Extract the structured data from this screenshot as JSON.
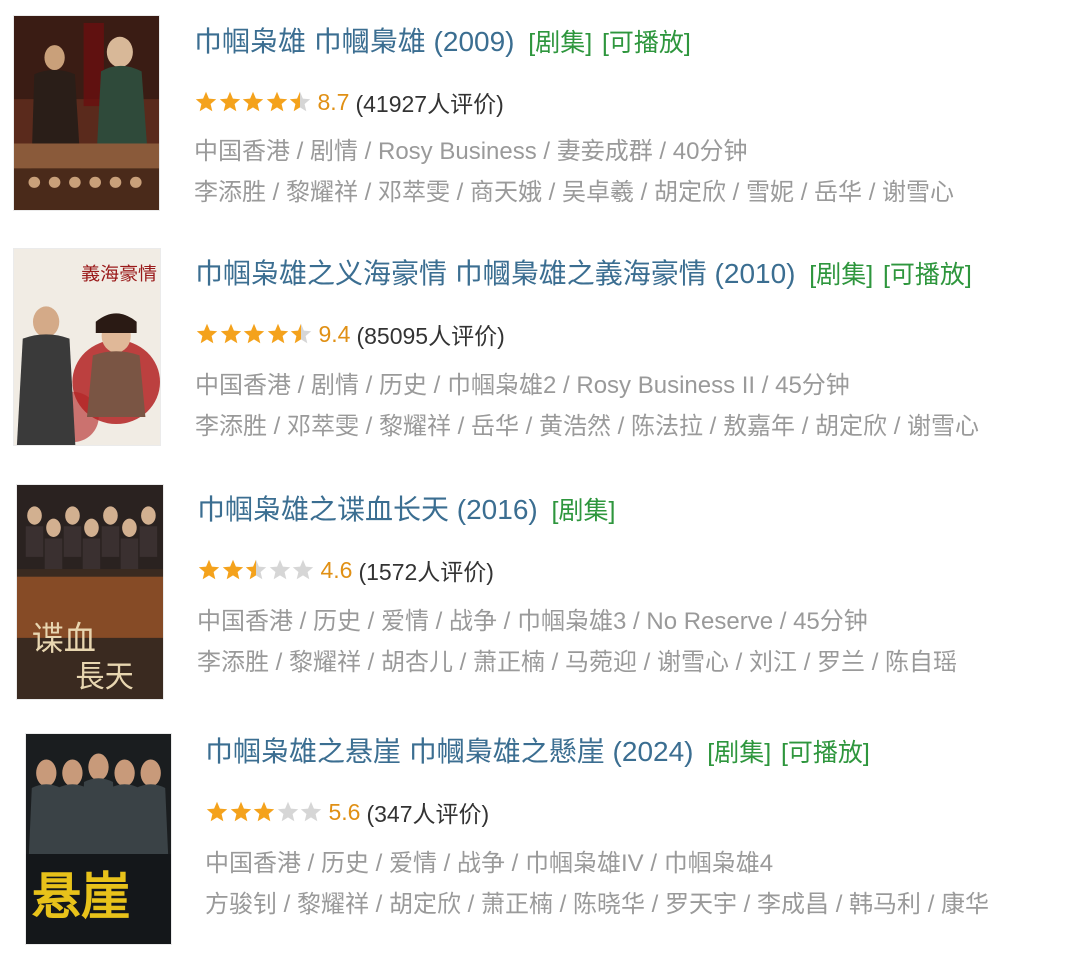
{
  "results": [
    {
      "title": "巾帼枭雄 巾幗梟雄 (2009)",
      "tags": [
        "[剧集]",
        "[可播放]"
      ],
      "rating": 4.5,
      "score": "8.7",
      "count": "(41927人评价)",
      "meta": [
        "中国香港",
        "剧情",
        "Rosy Business",
        "妻妾成群",
        "40分钟"
      ],
      "cast": [
        "李添胜",
        "黎耀祥",
        "邓萃雯",
        "商天娥",
        "吴卓羲",
        "胡定欣",
        "雪妮",
        "岳华",
        "谢雪心"
      ],
      "poster_colors": [
        "#5a2a1c",
        "#b88a5a",
        "#2f4a3a"
      ]
    },
    {
      "title": "巾帼枭雄之义海豪情 巾幗梟雄之義海豪情 (2010)",
      "tags": [
        "[剧集]",
        "[可播放]"
      ],
      "rating": 4.5,
      "score": "9.4",
      "count": "(85095人评价)",
      "meta": [
        "中国香港",
        "剧情",
        "历史",
        "巾帼枭雄2",
        "Rosy Business II",
        "45分钟"
      ],
      "cast": [
        "李添胜",
        "邓萃雯",
        "黎耀祥",
        "岳华",
        "黄浩然",
        "陈法拉",
        "敖嘉年",
        "胡定欣",
        "谢雪心"
      ],
      "poster_colors": [
        "#f1ece4",
        "#b32222",
        "#7a5544"
      ]
    },
    {
      "title": "巾帼枭雄之谍血长天 (2016)",
      "tags": [
        "[剧集]"
      ],
      "rating": 2.5,
      "score": "4.6",
      "count": "(1572人评价)",
      "meta": [
        "中国香港",
        "历史",
        "爱情",
        "战争",
        "巾帼枭雄3",
        "No Reserve",
        "45分钟"
      ],
      "cast": [
        "李添胜",
        "黎耀祥",
        "胡杏儿",
        "萧正楠",
        "马菀迎",
        "谢雪心",
        "刘江",
        "罗兰",
        "陈自瑶"
      ],
      "poster_colors": [
        "#3a2a20",
        "#a65a2a",
        "#e8d6b0"
      ]
    },
    {
      "title": "巾帼枭雄之悬崖 巾幗梟雄之懸崖 (2024)",
      "tags": [
        "[剧集]",
        "[可播放]"
      ],
      "rating": 3,
      "score": "5.6",
      "count": "(347人评价)",
      "meta": [
        "中国香港",
        "历史",
        "爱情",
        "战争",
        "巾帼枭雄IV",
        "巾帼枭雄4"
      ],
      "cast": [
        "方骏钊",
        "黎耀祥",
        "胡定欣",
        "萧正楠",
        "陈晓华",
        "罗天宇",
        "李成昌",
        "韩马利",
        "康华"
      ],
      "poster_colors": [
        "#1a1d1f",
        "#e8c21a",
        "#3a4246"
      ]
    }
  ],
  "colors": {
    "title": "#3b6e91",
    "tag": "#2e963d",
    "score": "#e09015",
    "meta": "#9a9a9a",
    "star_full": "#f4a21c",
    "star_empty": "#d6d6d6"
  },
  "star_max": 5
}
